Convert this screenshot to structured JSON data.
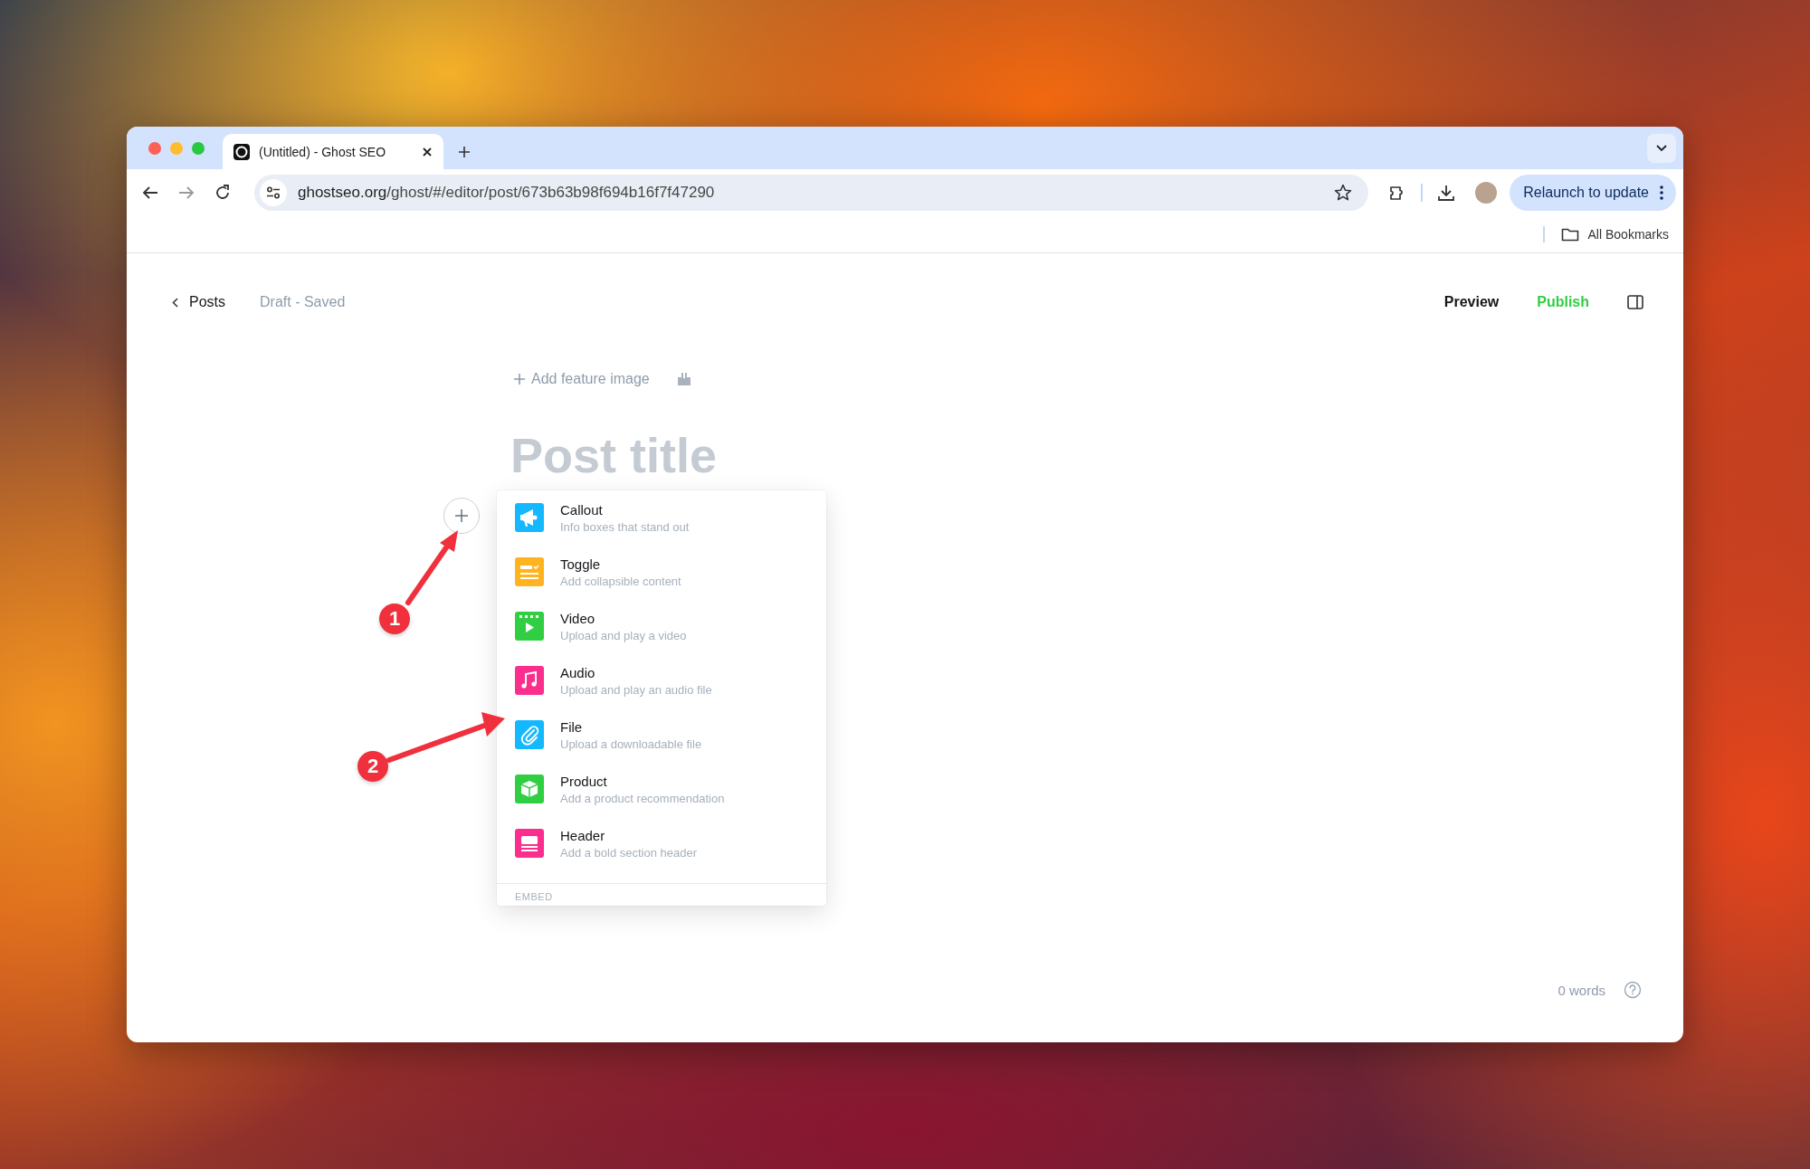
{
  "browser": {
    "tabs": [
      {
        "title": "(Untitled) - Ghost SEO",
        "selected": true
      }
    ],
    "url": {
      "domain": "ghostseo.org",
      "path": "/ghost/#/editor/post/673b63b98f694b16f7f47290"
    },
    "relaunch_button": "Relaunch to update",
    "bookmarks": "All Bookmarks"
  },
  "editor": {
    "back_link": "Posts",
    "status": "Draft - Saved",
    "preview": "Preview",
    "publish": "Publish",
    "feature_image": "Add feature image",
    "title_placeholder": "Post title",
    "word_count": "0 words"
  },
  "card_menu": {
    "items": [
      {
        "kind": "callout",
        "title": "Callout",
        "description": "Info boxes that stand out",
        "color": "#14b8ff"
      },
      {
        "kind": "toggle",
        "title": "Toggle",
        "description": "Add collapsible content",
        "color": "#ffb41f"
      },
      {
        "kind": "video",
        "title": "Video",
        "description": "Upload and play a video",
        "color": "#30cf43"
      },
      {
        "kind": "audio",
        "title": "Audio",
        "description": "Upload and play an audio file",
        "color": "#fb2d8d"
      },
      {
        "kind": "file",
        "title": "File",
        "description": "Upload a downloadable file",
        "color": "#14b8ff"
      },
      {
        "kind": "product",
        "title": "Product",
        "description": "Add a product recommendation",
        "color": "#30cf43"
      },
      {
        "kind": "header",
        "title": "Header",
        "description": "Add a bold section header",
        "color": "#fb2d8d"
      }
    ],
    "section": "EMBED"
  },
  "annotations": [
    {
      "label": "1"
    },
    {
      "label": "2"
    }
  ]
}
